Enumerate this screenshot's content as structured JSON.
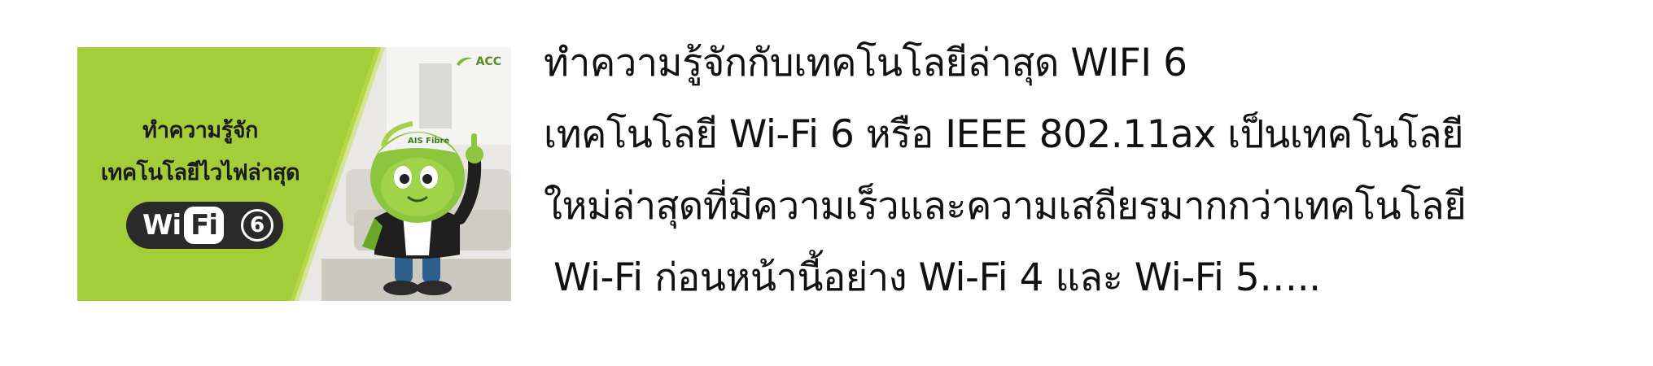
{
  "thumbnail": {
    "brand": "ACC",
    "title_line1": "ทำความรู้จัก",
    "title_line2": "เทคโนโลยีไวไฟล่าสุด",
    "badge": {
      "wi": "Wi",
      "fi": "Fi",
      "number": "6"
    },
    "mascot_cap_text": "AIS Fibre",
    "colors": {
      "green": "#a4cd3a",
      "badge_dark": "#2a2a2a",
      "mascot_green": "#8cc63f"
    },
    "icons": [
      "acc-logo-icon",
      "mascot-illustration",
      "sofa-illustration"
    ]
  },
  "article": {
    "lines": [
      "ทำความรู้จักกับเทคโนโลยีล่าสุด WIFI 6",
      "เทคโนโลยี Wi-Fi 6 หรือ IEEE 802.11ax เป็นเทคโนโลยี",
      "ใหม่ล่าสุดที่มีความเร็วและความเสถียรมากกว่าเทคโนโลยี",
      " Wi-Fi ก่อนหน้านี้อย่าง Wi-Fi 4 และ Wi-Fi 5….."
    ]
  }
}
